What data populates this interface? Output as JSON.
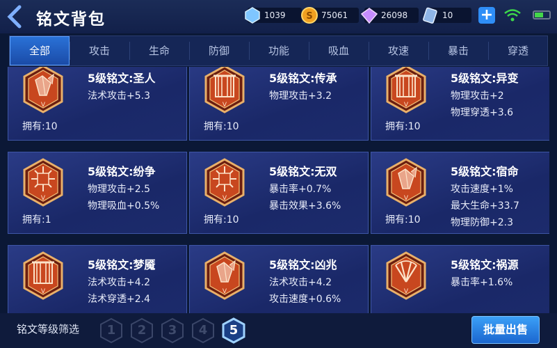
{
  "header": {
    "title": "铭文背包",
    "resources": [
      {
        "icon": "crystal-icon",
        "value": "1039"
      },
      {
        "icon": "coin-icon",
        "value": "75061"
      },
      {
        "icon": "diamond-icon",
        "value": "26098"
      },
      {
        "icon": "ticket-icon",
        "value": "10"
      }
    ]
  },
  "tabs": [
    "全部",
    "攻击",
    "生命",
    "防御",
    "功能",
    "吸血",
    "攻速",
    "暴击",
    "穿透"
  ],
  "cards": [
    {
      "name": "5级铭文:圣人",
      "attrs": [
        "法术攻击+5.3"
      ],
      "own": "拥有:10",
      "emblem": "crystal"
    },
    {
      "name": "5级铭文:传承",
      "attrs": [
        "物理攻击+3.2"
      ],
      "own": "拥有:10",
      "emblem": "gate"
    },
    {
      "name": "5级铭文:异变",
      "attrs": [
        "物理攻击+2",
        "物理穿透+3.6"
      ],
      "own": "拥有:10",
      "emblem": "gate"
    },
    {
      "name": "5级铭文:纷争",
      "attrs": [
        "物理攻击+2.5",
        "物理吸血+0.5%"
      ],
      "own": "拥有:1",
      "emblem": "star"
    },
    {
      "name": "5级铭文:无双",
      "attrs": [
        "暴击率+0.7%",
        "暴击效果+3.6%"
      ],
      "own": "拥有:10",
      "emblem": "star"
    },
    {
      "name": "5级铭文:宿命",
      "attrs": [
        "攻击速度+1%",
        "最大生命+33.7",
        "物理防御+2.3"
      ],
      "own": "拥有:10",
      "emblem": "crystal"
    },
    {
      "name": "5级铭文:梦魇",
      "attrs": [
        "法术攻击+4.2",
        "法术穿透+2.4"
      ],
      "own": "",
      "emblem": "gate"
    },
    {
      "name": "5级铭文:凶兆",
      "attrs": [
        "法术攻击+4.2",
        "攻击速度+0.6%"
      ],
      "own": "",
      "emblem": "crystal"
    },
    {
      "name": "5级铭文:祸源",
      "attrs": [
        "暴击率+1.6%"
      ],
      "own": "",
      "emblem": "fan"
    }
  ],
  "footer": {
    "filter_label": "铭文等级筛选",
    "levels": [
      "1",
      "2",
      "3",
      "4",
      "5"
    ],
    "active_level": "5",
    "sell_label": "批量出售"
  },
  "colors": {
    "accent": "#2f8ef7",
    "card_bg": "#1f2e74",
    "emblem": "#c8471f"
  }
}
